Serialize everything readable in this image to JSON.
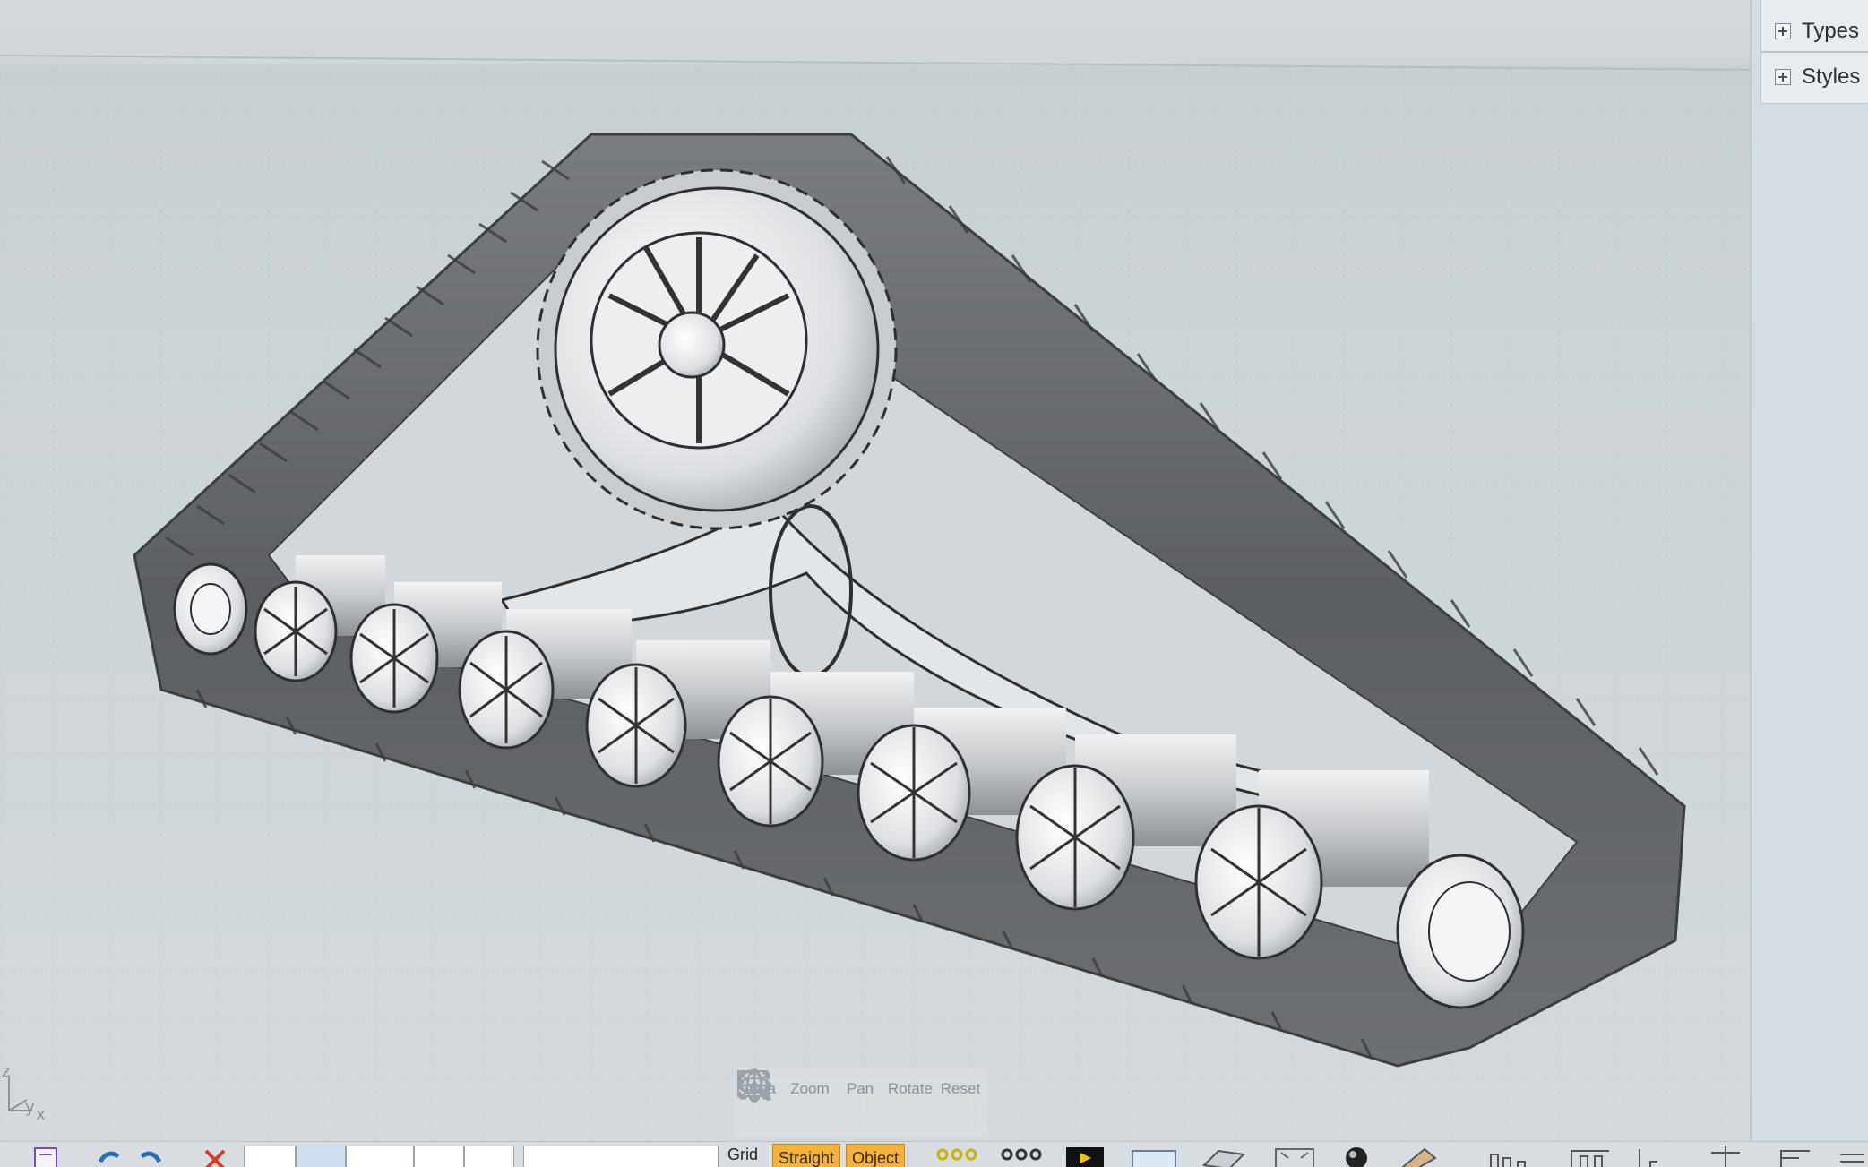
{
  "viewport": {
    "axis_indicator": {
      "z": "z",
      "y": "y",
      "x": "x"
    },
    "nav_tools": [
      {
        "name": "area",
        "label": "Area"
      },
      {
        "name": "zoom",
        "label": "Zoom"
      },
      {
        "name": "pan",
        "label": "Pan"
      },
      {
        "name": "rotate",
        "label": "Rotate"
      },
      {
        "name": "reset",
        "label": "Reset"
      }
    ]
  },
  "right_panel": {
    "groups": [
      {
        "label": "Types",
        "expanded": false
      },
      {
        "label": "Styles",
        "expanded": false
      }
    ]
  },
  "bottom_bar": {
    "grid_label": "Grid",
    "chip_straight": "Straight",
    "chip_object": "Object",
    "icons": [
      "save-icon",
      "undo-icon",
      "redo-icon",
      "delete-icon",
      "snap-points-icon",
      "snap-grid-icon",
      "render-icon",
      "view-icon",
      "plane-icon",
      "fit-icon",
      "material-icon",
      "tools-icon",
      "align-icon"
    ]
  },
  "colors": {
    "accent_chip": "#f3b23a",
    "delete": "#d33a2a",
    "viewport_bg": "#d0d6d9",
    "panel_bg": "#d4dde1"
  }
}
